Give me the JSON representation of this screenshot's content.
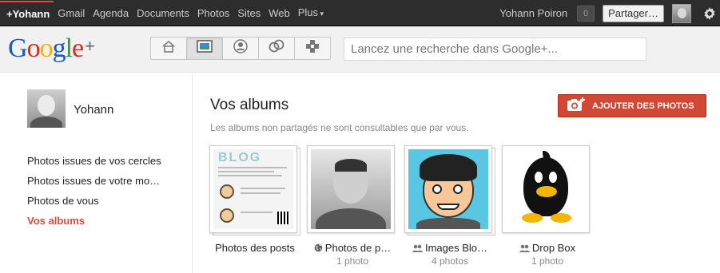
{
  "topbar": {
    "links": [
      "+Yohann",
      "Gmail",
      "Agenda",
      "Documents",
      "Photos",
      "Sites",
      "Web",
      "Plus"
    ],
    "user_name": "Yohann Poiron",
    "notification_count": "0",
    "share_label": "Partager…"
  },
  "header": {
    "logo_text": "Google",
    "logo_plus": "+",
    "logo_colors": [
      "#1a5bc4",
      "#d62d20",
      "#f4b400",
      "#1a5bc4",
      "#2c9f45",
      "#d62d20"
    ],
    "nav_icons": [
      "home-icon",
      "photos-icon",
      "profile-icon",
      "circles-icon",
      "games-icon"
    ],
    "active_nav": 1,
    "search_placeholder": "Lancez une recherche dans Google+..."
  },
  "sidebar": {
    "profile_name": "Yohann",
    "items": [
      {
        "label": "Photos issues de vos cercles",
        "active": false
      },
      {
        "label": "Photos issues de votre mo…",
        "active": false
      },
      {
        "label": "Photos de vous",
        "active": false
      },
      {
        "label": "Vos albums",
        "active": true
      }
    ]
  },
  "main": {
    "title": "Vos albums",
    "subtitle": "Les albums non partagés ne sont consultables que par vous.",
    "add_button": "AJOUTER DES PHOTOS",
    "accent_color": "#d14836",
    "albums": [
      {
        "label": "Photos des posts",
        "count": "",
        "icon": ""
      },
      {
        "label": "Photos de p…",
        "count": "1 photo",
        "icon": "globe-icon"
      },
      {
        "label": "Images Blo…",
        "count": "4 photos",
        "icon": "people-icon"
      },
      {
        "label": "Drop Box",
        "count": "1 photo",
        "icon": "people-icon"
      }
    ]
  }
}
